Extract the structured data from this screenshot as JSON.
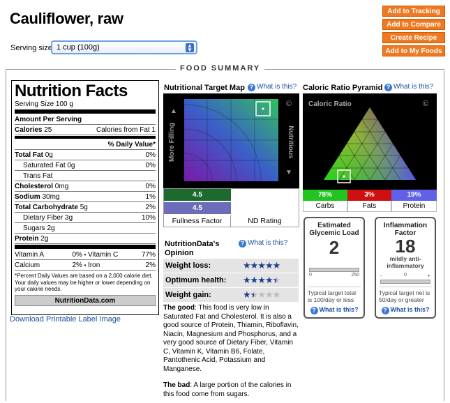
{
  "title": "Cauliflower, raw",
  "serving": {
    "label": "Serving size:",
    "selected": "1 cup (100g)"
  },
  "actions": [
    "Add to Tracking",
    "Add to Compare",
    "Create Recipe",
    "Add to My Foods"
  ],
  "summary_title": "FOOD SUMMARY",
  "label": {
    "heading": "Nutrition Facts",
    "serving_size": "Serving Size  100 g",
    "amount_per_serving": "Amount Per Serving",
    "calories_label": "Calories",
    "calories_value": "25",
    "calories_from_fat": "Calories from Fat 1",
    "daily_value_header": "% Daily Value*",
    "rows": [
      {
        "name": "Total Fat",
        "amt": "0g",
        "dv": "0%",
        "bold": true,
        "indent": false
      },
      {
        "name": "Saturated Fat",
        "amt": "0g",
        "dv": "0%",
        "bold": false,
        "indent": true
      },
      {
        "name": "Trans Fat",
        "amt": "",
        "dv": "",
        "bold": false,
        "indent": true
      },
      {
        "name": "Cholesterol",
        "amt": "0mg",
        "dv": "0%",
        "bold": true,
        "indent": false
      },
      {
        "name": "Sodium",
        "amt": "30mg",
        "dv": "1%",
        "bold": true,
        "indent": false
      },
      {
        "name": "Total Carbohydrate",
        "amt": "5g",
        "dv": "2%",
        "bold": true,
        "indent": false
      },
      {
        "name": "Dietary Fiber",
        "amt": "3g",
        "dv": "10%",
        "bold": false,
        "indent": true
      },
      {
        "name": "Sugars",
        "amt": "2g",
        "dv": "",
        "bold": false,
        "indent": true
      },
      {
        "name": "Protein",
        "amt": "2g",
        "dv": "",
        "bold": true,
        "indent": false
      }
    ],
    "vitamins": [
      {
        "a": "Vitamin A",
        "av": "0%",
        "b": "Vitamin C",
        "bv": "77%"
      },
      {
        "a": "Calcium",
        "av": "2%",
        "b": "Iron",
        "bv": "2%"
      }
    ],
    "footnote": "*Percent Daily Values are based on a 2,000 calorie diet. Your daily values may be higher or lower depending on your calorie needs.",
    "site": "NutritionData.com"
  },
  "download_link": "Download Printable Label Image",
  "target_map": {
    "title": "Nutritional Target Map",
    "what": "What is this?",
    "axis_left": "More Filling",
    "axis_right": "Nutritious",
    "copyright": "©",
    "fullness_value": "4.5",
    "fullness_bar": "4.5",
    "fullness_label": "Fullness Factor",
    "nd_label": "ND Rating"
  },
  "pyramid": {
    "title": "Caloric Ratio Pyramid",
    "what": "What is this?",
    "inner_label": "Caloric Ratio",
    "copyright": "©",
    "carbs_pct": "78%",
    "fats_pct": "3%",
    "protein_pct": "19%",
    "carbs_label": "Carbs",
    "fats_label": "Fats",
    "protein_label": "Protein",
    "colors": {
      "carbs": "#22c422",
      "fats": "#d01010",
      "protein": "#6060e8"
    }
  },
  "opinion": {
    "title": "NutritionData's Opinion",
    "what": "What is this?",
    "rows": [
      {
        "label": "Weight loss:",
        "stars": 5
      },
      {
        "label": "Optimum health:",
        "stars": 4.5
      },
      {
        "label": "Weight gain:",
        "stars": 1.5
      }
    ],
    "good_label": "The good",
    "good_text": ": This food is very low in Saturated Fat and Cholesterol. It is also a good source of Protein, Thiamin, Riboflavin, Niacin, Magnesium and Phosphorus, and a very good source of Dietary Fiber, Vitamin C, Vitamin K, Vitamin B6, Folate, Pantothenic Acid, Potassium and Manganese.",
    "bad_label": "The bad",
    "bad_text": ": A large portion of the calories in this food come from sugars."
  },
  "glycemic": {
    "title": "Estimated Glycemic Load",
    "value": "2",
    "scale_min": "0",
    "scale_max": "250",
    "desc": "Typical target total is 100/day or less",
    "what": "What is this?"
  },
  "inflammation": {
    "title": "Inflammation Factor",
    "value": "18",
    "sub": "mildly anti-inflammatory",
    "scale_min": "-",
    "scale_mid": "0",
    "scale_max": "+",
    "desc": "Typical target net is 50/day or greater",
    "what": "What is this?"
  }
}
